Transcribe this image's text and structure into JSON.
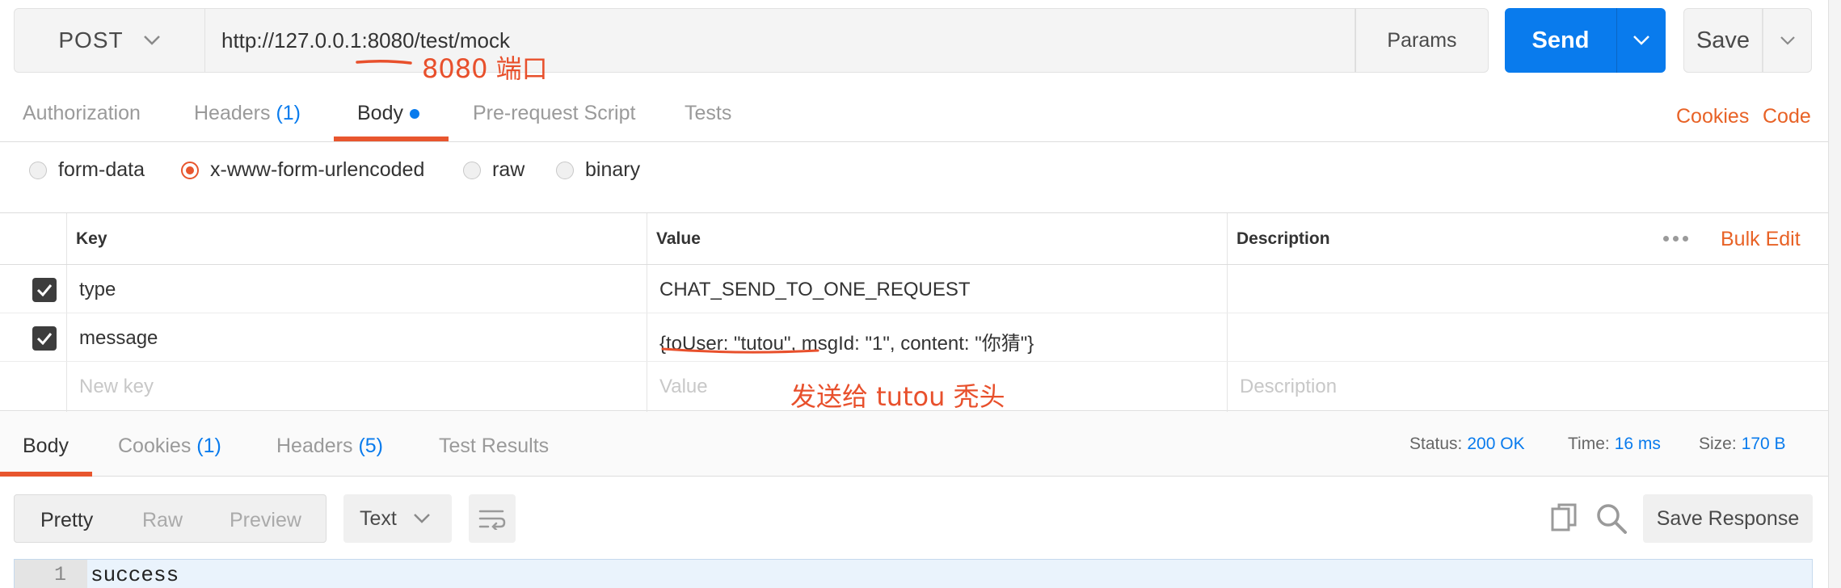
{
  "request": {
    "method": "POST",
    "url": "http://127.0.0.1:8080/test/mock",
    "params_label": "Params",
    "send_label": "Send",
    "save_label": "Save"
  },
  "annotations": {
    "port": "8080 端口",
    "send_to": "发送给 tutou 秃头"
  },
  "request_tabs": {
    "authorization": "Authorization",
    "headers": "Headers",
    "headers_count": "(1)",
    "body": "Body",
    "pre_request": "Pre-request Script",
    "tests": "Tests",
    "cookies": "Cookies",
    "code": "Code"
  },
  "body_types": {
    "form_data": "form-data",
    "urlencoded": "x-www-form-urlencoded",
    "raw": "raw",
    "binary": "binary",
    "selected": "x-www-form-urlencoded"
  },
  "kv_table": {
    "headers": {
      "key": "Key",
      "value": "Value",
      "description": "Description",
      "bulk_edit": "Bulk Edit"
    },
    "rows": [
      {
        "key": "type",
        "value": "CHAT_SEND_TO_ONE_REQUEST",
        "checked": true
      },
      {
        "key": "message",
        "value": "{toUser: \"tutou\", msgId: \"1\", content: \"你猜\"}",
        "checked": true
      }
    ],
    "placeholders": {
      "key": "New key",
      "value": "Value",
      "description": "Description"
    }
  },
  "response_tabs": {
    "body": "Body",
    "cookies": "Cookies",
    "cookies_count": "(1)",
    "headers": "Headers",
    "headers_count": "(5)",
    "test_results": "Test Results"
  },
  "status": {
    "status_label": "Status:",
    "status_value": "200 OK",
    "time_label": "Time:",
    "time_value": "16 ms",
    "size_label": "Size:",
    "size_value": "170 B"
  },
  "response_toolbar": {
    "pretty": "Pretty",
    "raw": "Raw",
    "preview": "Preview",
    "format": "Text",
    "save_response": "Save Response"
  },
  "response_body": {
    "line_number": "1",
    "line": "success"
  },
  "colors": {
    "accent_orange": "#e8562e",
    "send_blue": "#097bed",
    "link_blue": "#097bed"
  },
  "icons": [
    "chevron-down-icon",
    "wrap-lines-icon",
    "copy-icon",
    "search-icon",
    "more-dots-icon",
    "checkbox-checked-icon"
  ]
}
